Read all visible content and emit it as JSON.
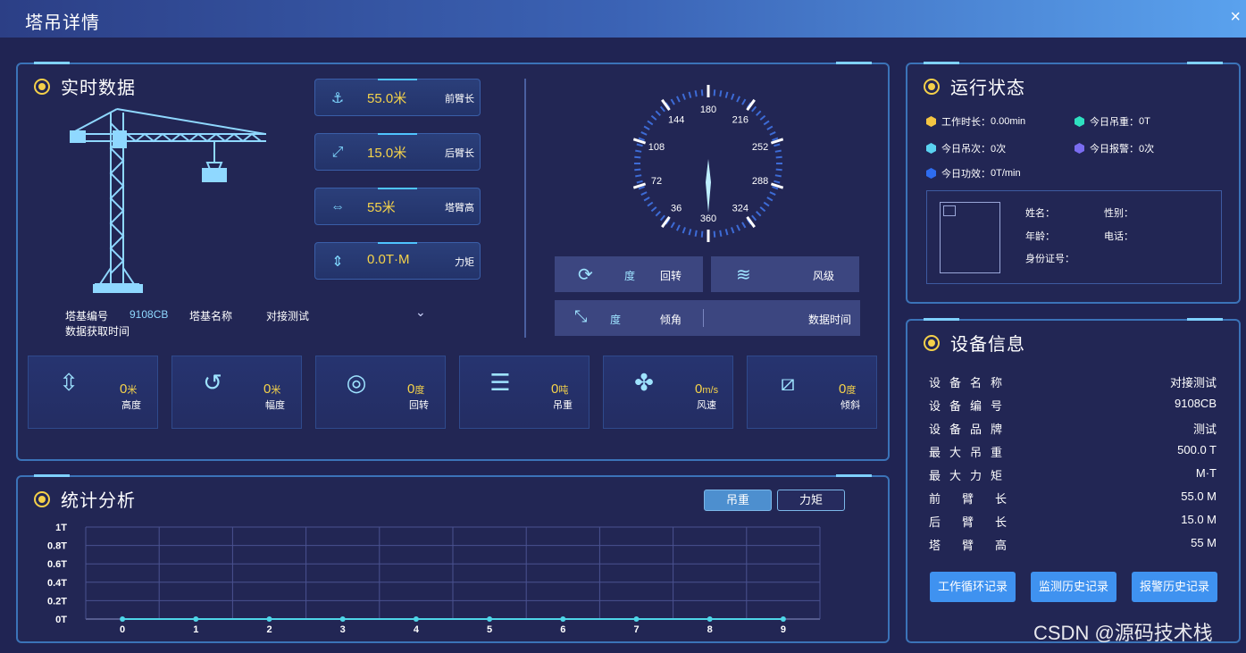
{
  "window": {
    "title": "塔吊详情",
    "close": "×"
  },
  "realtime": {
    "title": "实时数据",
    "cards": [
      {
        "value": "55.0米",
        "label": "前臂长",
        "icon": "hook-icon"
      },
      {
        "value": "15.0米",
        "label": "后臂长",
        "icon": "rear-arm-icon"
      },
      {
        "value": "55米",
        "label": "塔臂高",
        "icon": "arm-height-icon"
      },
      {
        "value": "0.0T·M",
        "label": "力矩",
        "icon": "torque-icon"
      }
    ],
    "info": {
      "base_no_label": "塔基编号",
      "base_no": "9108CB",
      "base_name_label": "塔基名称",
      "base_name": "对接测试",
      "time_label": "数据获取时间"
    },
    "compass_ticks": [
      "180",
      "216",
      "252",
      "288",
      "324",
      "360",
      "36",
      "72",
      "108",
      "144"
    ],
    "status_boxes": {
      "rotation_unit": "度",
      "rotation_label": "回转",
      "wind_label": "风级",
      "tilt_unit": "度",
      "tilt_label": "倾角",
      "data_time_label": "数据时间"
    },
    "metrics": [
      {
        "value": "0",
        "unit": "米",
        "label": "高度",
        "icon": "height-icon"
      },
      {
        "value": "0",
        "unit": "米",
        "label": "幅度",
        "icon": "range-icon"
      },
      {
        "value": "0",
        "unit": "度",
        "label": "回转",
        "icon": "rotation-icon"
      },
      {
        "value": "0",
        "unit": "吨",
        "label": "吊重",
        "icon": "load-icon"
      },
      {
        "value": "0",
        "unit": "m/s",
        "label": "风速",
        "icon": "wind-speed-icon"
      },
      {
        "value": "0",
        "unit": "度",
        "label": "倾斜",
        "icon": "tilt-icon"
      }
    ]
  },
  "stats": {
    "title": "统计分析",
    "tabs": [
      "吊重",
      "力矩"
    ],
    "active_tab": 0
  },
  "chart_data": {
    "type": "line",
    "x": [
      0,
      1,
      2,
      3,
      4,
      5,
      6,
      7,
      8,
      9
    ],
    "y_ticks": [
      "0T",
      "0.2T",
      "0.4T",
      "0.6T",
      "0.8T",
      "1T"
    ],
    "ylim": [
      0,
      1
    ],
    "series": [
      {
        "values": [
          0,
          0,
          0,
          0,
          0,
          0,
          0,
          0,
          0,
          0
        ],
        "color": "#4fd6e8"
      }
    ],
    "grid": true
  },
  "running": {
    "title": "运行状态",
    "items": [
      {
        "label": "工作时长：",
        "value": "0.00min",
        "color": "#f4c542"
      },
      {
        "label": "今日吊重：",
        "value": "0T",
        "color": "#2ee0c0"
      },
      {
        "label": "今日吊次：",
        "value": "0次",
        "color": "#5ad2f0"
      },
      {
        "label": "今日报警：",
        "value": "0次",
        "color": "#7a6cf0"
      },
      {
        "label": "今日功效：",
        "value": "0T/min",
        "color": "#2e6cf0"
      }
    ],
    "operator": {
      "name_label": "姓名：",
      "gender_label": "性别：",
      "age_label": "年龄：",
      "phone_label": "电话：",
      "id_label": "身份证号："
    }
  },
  "device": {
    "title": "设备信息",
    "rows": [
      {
        "k": "设备名称",
        "v": "对接测试"
      },
      {
        "k": "设备编号",
        "v": "9108CB"
      },
      {
        "k": "设备品牌",
        "v": "测试"
      },
      {
        "k": "最大吊重",
        "v": "500.0 T"
      },
      {
        "k": "最大力矩",
        "v": "M·T"
      },
      {
        "k": "前臂长",
        "v": "55.0 M"
      },
      {
        "k": "后臂长",
        "v": "15.0 M"
      },
      {
        "k": "塔臂高",
        "v": "55 M"
      }
    ],
    "buttons": [
      "工作循环记录",
      "监测历史记录",
      "报警历史记录"
    ]
  },
  "watermark": "CSDN @源码技术栈"
}
